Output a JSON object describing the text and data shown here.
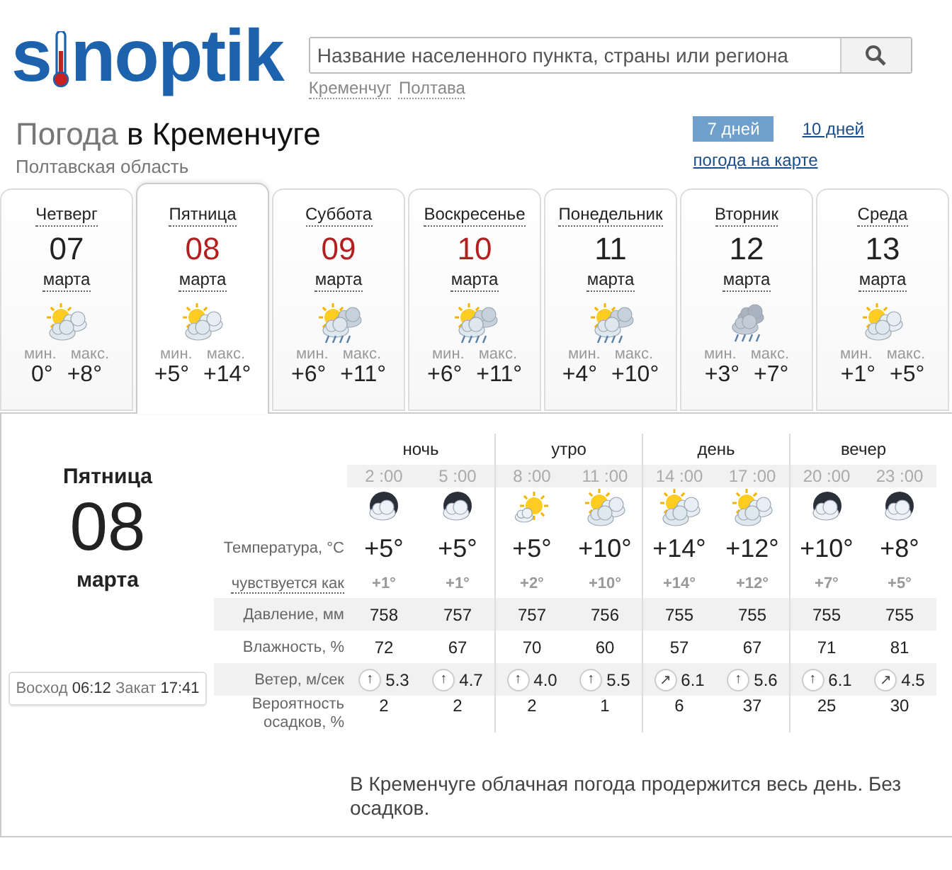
{
  "logo": {
    "before": "s",
    "after": "noptik"
  },
  "search": {
    "placeholder": "Название населенного пункта, страны или региона"
  },
  "recent": [
    "Кременчуг",
    "Полтава"
  ],
  "title": {
    "lead": "Погода",
    "place": "в Кременчуге"
  },
  "region": "Полтавская область",
  "ranges": [
    {
      "label": "7 дней",
      "selected": true
    },
    {
      "label": "10 дней",
      "selected": false
    }
  ],
  "map_link": "погода на карте",
  "days": [
    {
      "weekday": "Четверг",
      "date": "07",
      "month": "марта",
      "holiday": false,
      "selected": false,
      "kind": "sun-cloud",
      "min_label": "мин.",
      "max_label": "макс.",
      "min": "0°",
      "max": "+8°"
    },
    {
      "weekday": "Пятница",
      "date": "08",
      "month": "марта",
      "holiday": true,
      "selected": true,
      "kind": "sun-cloud",
      "min_label": "мин.",
      "max_label": "макс.",
      "min": "+5°",
      "max": "+14°"
    },
    {
      "weekday": "Суббота",
      "date": "09",
      "month": "марта",
      "holiday": true,
      "selected": false,
      "kind": "sun-cloud-rain",
      "min_label": "мин.",
      "max_label": "макс.",
      "min": "+6°",
      "max": "+11°"
    },
    {
      "weekday": "Воскресенье",
      "date": "10",
      "month": "марта",
      "holiday": true,
      "selected": false,
      "kind": "sun-cloud-rain",
      "min_label": "мин.",
      "max_label": "макс.",
      "min": "+6°",
      "max": "+11°"
    },
    {
      "weekday": "Понедельник",
      "date": "11",
      "month": "марта",
      "holiday": false,
      "selected": false,
      "kind": "sun-cloud-rain",
      "min_label": "мин.",
      "max_label": "макс.",
      "min": "+4°",
      "max": "+10°"
    },
    {
      "weekday": "Вторник",
      "date": "12",
      "month": "марта",
      "holiday": false,
      "selected": false,
      "kind": "cloud-rain",
      "min_label": "мин.",
      "max_label": "макс.",
      "min": "+3°",
      "max": "+7°"
    },
    {
      "weekday": "Среда",
      "date": "13",
      "month": "марта",
      "holiday": false,
      "selected": false,
      "kind": "sun-cloud",
      "min_label": "мин.",
      "max_label": "макс.",
      "min": "+1°",
      "max": "+5°"
    }
  ],
  "detail": {
    "weekday": "Пятница",
    "date": "08",
    "month": "марта",
    "sun": "Восход **06:12** Закат **17:41**",
    "row_labels": {
      "temp": "Температура, °C",
      "feels": "чувствуется как",
      "pressure": "Давление, мм",
      "humidity": "Влажность, %",
      "wind": "Ветер, м/сек",
      "precip": "Вероятность осадков, %"
    },
    "periods": [
      {
        "label": "ночь",
        "hours": [
          {
            "time": "2 :00",
            "kind": "night-cloud",
            "temp": "+5°",
            "feels": "+1°",
            "pressure": "758",
            "humidity": "72",
            "wind_arrow": "↑",
            "wind": "5.3",
            "precip": "2"
          },
          {
            "time": "5 :00",
            "kind": "night-cloud",
            "temp": "+5°",
            "feels": "+1°",
            "pressure": "757",
            "humidity": "67",
            "wind_arrow": "↑",
            "wind": "4.7",
            "precip": "2"
          }
        ]
      },
      {
        "label": "утро",
        "hours": [
          {
            "time": "8 :00",
            "kind": "sun",
            "temp": "+5°",
            "feels": "+2°",
            "pressure": "757",
            "humidity": "70",
            "wind_arrow": "↑",
            "wind": "4.0",
            "precip": "2"
          },
          {
            "time": "11 :00",
            "kind": "sun-cloud",
            "temp": "+10°",
            "feels": "+10°",
            "pressure": "756",
            "humidity": "60",
            "wind_arrow": "↑",
            "wind": "5.5",
            "precip": "1"
          }
        ]
      },
      {
        "label": "день",
        "hours": [
          {
            "time": "14 :00",
            "kind": "sun-cloud",
            "temp": "+14°",
            "feels": "+14°",
            "pressure": "755",
            "humidity": "57",
            "wind_arrow": "↗",
            "wind": "6.1",
            "precip": "6"
          },
          {
            "time": "17 :00",
            "kind": "sun-cloud",
            "temp": "+12°",
            "feels": "+12°",
            "pressure": "755",
            "humidity": "67",
            "wind_arrow": "↑",
            "wind": "5.6",
            "precip": "37"
          }
        ]
      },
      {
        "label": "вечер",
        "hours": [
          {
            "time": "20 :00",
            "kind": "night-cloud",
            "temp": "+10°",
            "feels": "+7°",
            "pressure": "755",
            "humidity": "71",
            "wind_arrow": "↑",
            "wind": "6.1",
            "precip": "25"
          },
          {
            "time": "23 :00",
            "kind": "night-cloud",
            "temp": "+8°",
            "feels": "+5°",
            "pressure": "755",
            "humidity": "81",
            "wind_arrow": "↗",
            "wind": "4.5",
            "precip": "30"
          }
        ]
      }
    ],
    "description": "В Кременчуге облачная погода продержится весь день. Без осадков."
  }
}
